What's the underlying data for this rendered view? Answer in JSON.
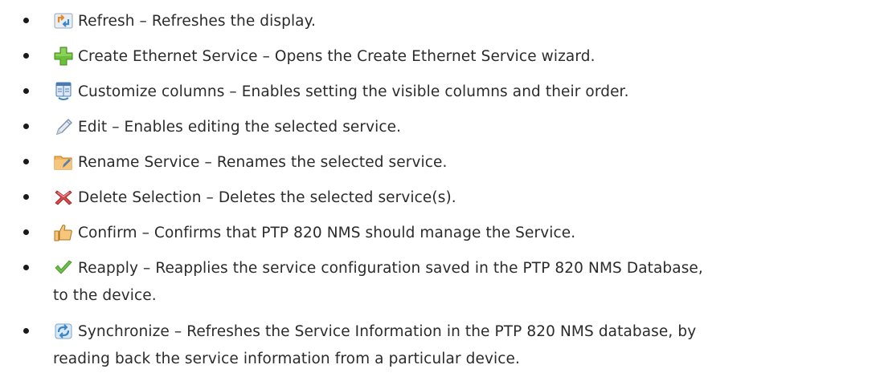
{
  "items": [
    {
      "icon": "refresh-icon",
      "text": "Refresh – Refreshes the display."
    },
    {
      "icon": "plus-icon",
      "text": "Create Ethernet Service – Opens the Create Ethernet Service wizard."
    },
    {
      "icon": "columns-icon",
      "text": "Customize columns – Enables setting the visible columns and their order."
    },
    {
      "icon": "pencil-icon",
      "text": "Edit – Enables editing the selected service."
    },
    {
      "icon": "folder-rename-icon",
      "text": "Rename Service – Renames the selected service."
    },
    {
      "icon": "delete-x-icon",
      "text": "Delete Selection – Deletes the selected service(s)."
    },
    {
      "icon": "thumbs-up-icon",
      "text": "Confirm – Confirms that PTP 820 NMS should manage the Service."
    },
    {
      "icon": "checkmark-icon",
      "text": "Reapply – Reapplies the service configuration saved in the PTP 820 NMS Database,",
      "text_cont": "to the device."
    },
    {
      "icon": "sync-icon",
      "text": "Synchronize – Refreshes the Service Information in the PTP 820 NMS database, by",
      "text_cont": "reading back the service information from a particular device."
    }
  ],
  "colors": {
    "text": "#2b2b2b",
    "bullet": "#1a1a1a",
    "plus": "#6cbf3a",
    "delete": "#d84a4a",
    "check": "#6cc04a",
    "folder": "#e8a040"
  }
}
